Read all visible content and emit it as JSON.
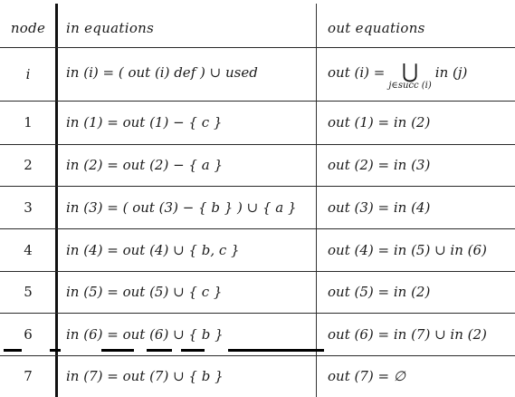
{
  "header": {
    "node": "node",
    "in": "in equations",
    "out": "out equations"
  },
  "rows": [
    {
      "node": "i",
      "in": "in (i) = ( out (i)    def ) ∪ used",
      "out_prefix": "out (i) =",
      "out_sym": "⋃",
      "out_sub": "j∈succ (i)",
      "out_suffix": "in (j)"
    },
    {
      "node": "1",
      "in": "in (1) = out (1) − { c }",
      "out": "out (1) = in (2)"
    },
    {
      "node": "2",
      "in": "in (2) = out (2) − { a }",
      "out": "out (2) = in (3)"
    },
    {
      "node": "3",
      "in": "in (3) = ( out (3) − { b } ) ∪ { a }",
      "out": "out (3) = in (4)"
    },
    {
      "node": "4",
      "in": "in (4) = out (4) ∪ { b, c }",
      "out": "out (4) = in (5) ∪ in (6)"
    },
    {
      "node": "5",
      "in": "in (5) = out (5) ∪ { c }",
      "out": "out (5) = in (2)"
    },
    {
      "node": "6",
      "in": "in (6) = out (6) ∪ { b }",
      "out": "out (6) = in (7) ∪ in (2)"
    },
    {
      "node": "7",
      "in": "in (7) = out (7) ∪ { b }",
      "out": "out (7) = ∅"
    }
  ]
}
